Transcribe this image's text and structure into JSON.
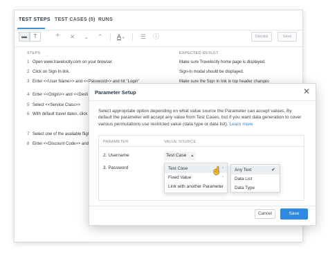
{
  "tabs": [
    {
      "label": "TEST STEPS",
      "active": true
    },
    {
      "label": "TEST CASES (5)",
      "active": false
    },
    {
      "label": "RUNS",
      "active": false
    }
  ],
  "toolbar": {
    "icons": [
      "align-icon",
      "text-format-icon",
      "add-icon",
      "close-icon",
      "move-down-icon",
      "move-up-icon",
      "font-icon",
      "settings-icon",
      "help-icon"
    ],
    "font_label": "A",
    "discard_label": "Discard",
    "save_label": "Save"
  },
  "columns": {
    "steps": "STEPS",
    "expected": "EXPECTED RESULT"
  },
  "steps": [
    {
      "num": "1",
      "text": "Open www.travelocity.com on your browser."
    },
    {
      "num": "2",
      "text": "Click on Sign In link."
    },
    {
      "num": "3",
      "text": "Enter <<User Name>> and <<Password>> and hit \"Login\""
    },
    {
      "num": "4",
      "text": "Enter <<Origin>> and <<Desti"
    },
    {
      "num": "5",
      "text": "Select <<Service Class>>"
    },
    {
      "num": "6",
      "text": "With default travel dates, click"
    },
    {
      "num": "7",
      "text": "Select one of the available fligh"
    },
    {
      "num": "8",
      "text": "Enter <<Discount Code>> and"
    }
  ],
  "expected_results": [
    "Make sure Travelocity home page is displayed.",
    "Sign-In modal should be displayed.",
    "Make sure the Sign In link in top header changes"
  ],
  "dialog": {
    "title": "Parameter Setup",
    "description": "Select appropriate option depending on what value source the Parameter can accept values. By default the parameter will accept any value from Test Cases, but if you want data generation to cover various permutations use restricted value (data type or data list).",
    "learn_more": "Learn more",
    "table_headers": {
      "parameter": "PARAMETER",
      "value_source": "VALUE SOURCE"
    },
    "parameters": [
      {
        "name": "2. Username",
        "value_source": "Test Case"
      },
      {
        "name": "3. Password",
        "value_source": ""
      }
    ],
    "dropdown_items": [
      {
        "label": "Test Case",
        "has_submenu": true,
        "hover": true
      },
      {
        "label": "Fixed Value",
        "has_submenu": true,
        "hover": false
      },
      {
        "label": "Link with another Parameter",
        "has_submenu": false,
        "hover": false
      }
    ],
    "submenu_items": [
      {
        "label": "Any Text",
        "checked": true
      },
      {
        "label": "Data List",
        "checked": false
      },
      {
        "label": "Data Type",
        "checked": false
      }
    ],
    "cancel_label": "Cancel",
    "save_label": "Save"
  },
  "colors": {
    "accent": "#2e8ae0",
    "link": "#2e7fc9",
    "tab_underline": "#3d8fd6"
  }
}
